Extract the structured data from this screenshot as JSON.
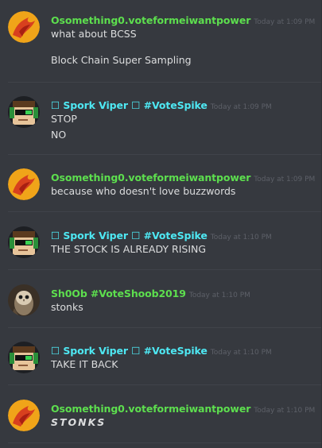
{
  "users": {
    "osomething": {
      "name": "Osomething0.voteformeiwantpower",
      "color": "#5ddf4e"
    },
    "spork": {
      "name": "☐ Spork Viper ☐ #VoteSpike",
      "color": "#4ee8f3"
    },
    "shoob": {
      "name": "Sh0Ob #VoteShoob2019",
      "color": "#5ddf4e"
    }
  },
  "messages": [
    {
      "user": "Osomething0.voteformeiwantpower",
      "time": "Today at 1:09 PM",
      "lines": [
        "what about BCSS",
        "Block Chain Super Sampling"
      ]
    },
    {
      "user": "☐ Spork Viper ☐ #VoteSpike",
      "time": "Today at 1:09 PM",
      "lines": [
        "STOP",
        "NO"
      ]
    },
    {
      "user": "Osomething0.voteformeiwantpower",
      "time": "Today at 1:09 PM",
      "lines": [
        "because who doesn't love buzzwords"
      ]
    },
    {
      "user": "☐ Spork Viper ☐ #VoteSpike",
      "time": "Today at 1:10 PM",
      "lines": [
        "THE STOCK IS ALREADY RISING"
      ]
    },
    {
      "user": "Sh0Ob #VoteShoob2019",
      "time": "Today at 1:10 PM",
      "lines": [
        "stonks"
      ]
    },
    {
      "user": "☐ Spork Viper ☐ #VoteSpike",
      "time": "Today at 1:10 PM",
      "lines": [
        "TAKE IT BACK"
      ]
    },
    {
      "user": "Osomething0.voteformeiwantpower",
      "time": "Today at 1:10 PM",
      "lines": [
        "STONKS"
      ]
    }
  ]
}
